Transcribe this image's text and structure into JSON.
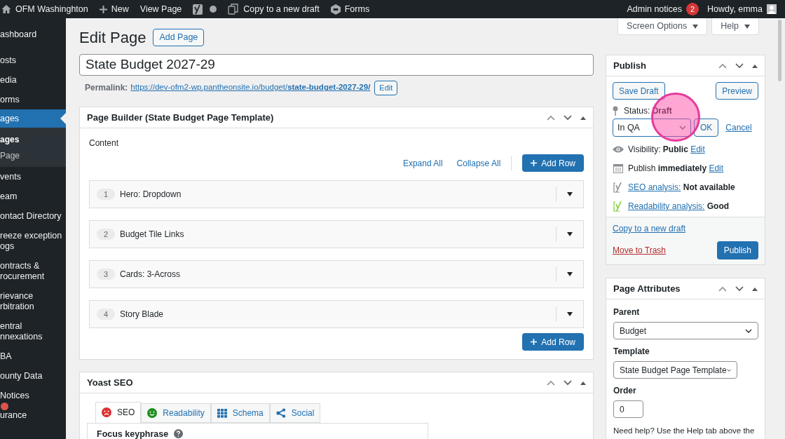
{
  "admin_bar": {
    "site": "OFM Washinghton",
    "new": "New",
    "view": "View Page",
    "copy": "Copy to a new draft",
    "forms": "Forms",
    "notices": "Admin notices",
    "notice_count": "2",
    "howdy": "Howdy, emma"
  },
  "sidebar": {
    "items": [
      {
        "lines": [
          "ashboard"
        ],
        "selected": false
      },
      {
        "lines": [
          "osts"
        ],
        "selected": false
      },
      {
        "lines": [
          "edia"
        ],
        "selected": false
      },
      {
        "lines": [
          "orms"
        ],
        "selected": false
      },
      {
        "lines": [
          "ages"
        ],
        "selected": true,
        "children": [
          {
            "label": "ages",
            "selected": true
          },
          {
            "label": "Page",
            "selected": false
          }
        ]
      },
      {
        "lines": [
          "vents"
        ],
        "selected": false
      },
      {
        "lines": [
          "eam"
        ],
        "selected": false
      },
      {
        "lines": [
          "ontact Directory"
        ],
        "selected": false
      },
      {
        "lines": [
          "reeze exception",
          "ogs"
        ],
        "selected": false
      },
      {
        "lines": [
          "ontracts &",
          "rocurement"
        ],
        "selected": false
      },
      {
        "lines": [
          "rievance",
          "rbitration"
        ],
        "selected": false
      },
      {
        "lines": [
          "entral",
          "nnexations"
        ],
        "selected": false
      },
      {
        "lines": [
          "BA"
        ],
        "selected": false
      },
      {
        "lines": [
          "ounty Data"
        ],
        "selected": false
      },
      {
        "lines": [
          "Notices"
        ],
        "selected": false
      },
      {
        "lines": [
          "urance"
        ],
        "selected": false
      }
    ]
  },
  "header": {
    "title": "Edit Page",
    "add": "Add Page",
    "screen_options": "Screen Options",
    "help": "Help"
  },
  "post_title": "State Budget 2027-29",
  "permalink": {
    "label": "Permalink:",
    "url": "https://dev-ofm2-wp.pantheonsite.io/budget/**state-budget-2027-29/**",
    "edit": "Edit"
  },
  "page_builder": {
    "title": "Page Builder (State Budget Page Template)",
    "content_label": "Content",
    "expand": "Expand All",
    "collapse": "Collapse All",
    "add_row_top": "Add Row",
    "add_row_bottom": "Add Row",
    "rows": [
      {
        "number": "1",
        "title": "Hero: Dropdown"
      },
      {
        "number": "2",
        "title": "Budget Tile Links"
      },
      {
        "number": "3",
        "title": "Cards: 3-Across"
      },
      {
        "number": "4",
        "title": "Story Blade"
      }
    ]
  },
  "yoast": {
    "title": "Yoast SEO",
    "tabs": [
      {
        "kind": "sad",
        "label": "SEO",
        "selected": true
      },
      {
        "kind": "smile",
        "label": "Readability",
        "selected": false
      },
      {
        "kind": "grid",
        "label": "Schema",
        "selected": false
      },
      {
        "kind": "share",
        "label": "Social",
        "selected": false
      }
    ],
    "focus": "Focus keyphrase"
  },
  "publish": {
    "title": "Publish",
    "save": "Save Draft",
    "preview": "Preview",
    "status_label": "Status:",
    "status": "Draft",
    "status_select": "In QA",
    "ok": "OK",
    "cancel": "Cancel",
    "meta": [
      {
        "kind": "eye",
        "text": "Visibility: **Public**",
        "link": "Edit"
      },
      {
        "kind": "calendar",
        "text": "Publish **immediately**",
        "link": "Edit"
      },
      {
        "kind": "yoast-grey",
        "link": "SEO analysis:",
        "text": "**Not available**"
      },
      {
        "kind": "yoast-green",
        "link": "Readability analysis:",
        "text": "**Good**"
      }
    ],
    "copy": "Copy to a new draft",
    "trash": "Move to Trash",
    "publish": "Publish"
  },
  "attributes": {
    "title": "Page Attributes",
    "parent_label": "Parent",
    "parent": "Budget",
    "template_label": "Template",
    "template": "State Budget Page Template",
    "order_label": "Order",
    "order": "0",
    "help": "Need help? Use the Help tab above the"
  }
}
